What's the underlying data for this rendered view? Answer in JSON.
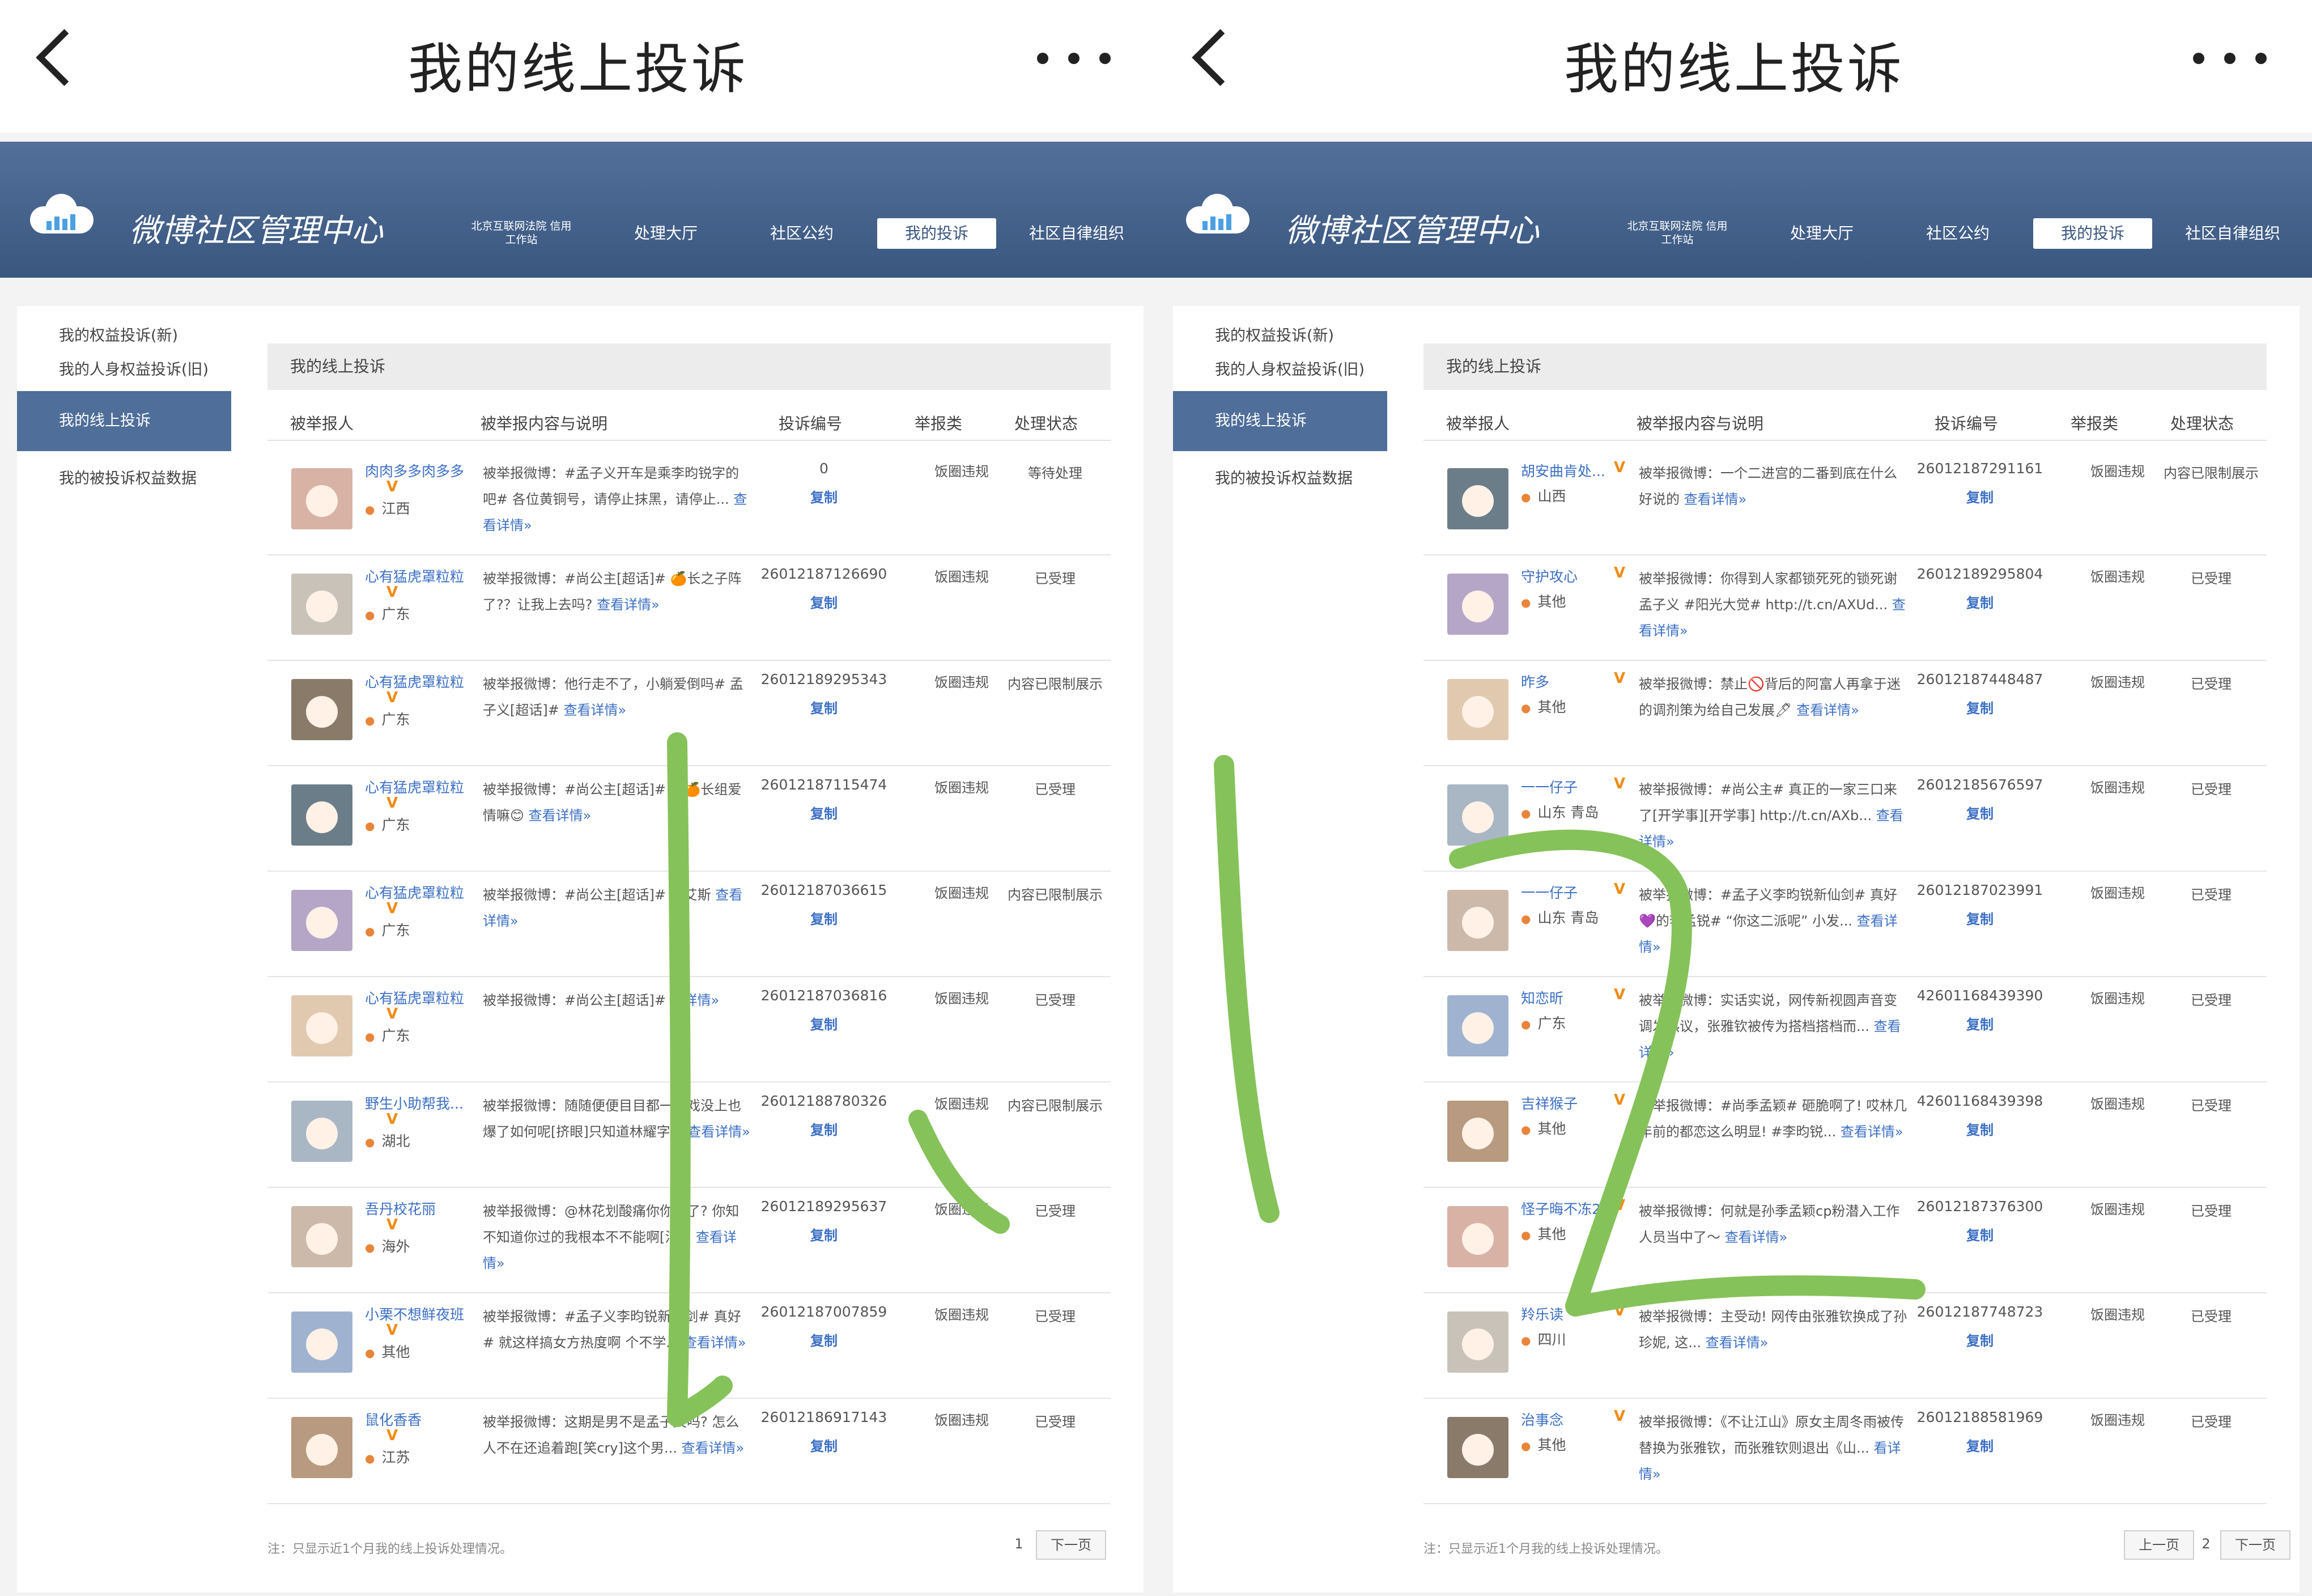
{
  "panels": [
    {
      "title": "我的线上投诉",
      "site_name": "微博社区管理中心",
      "nav": [
        "北京互联网法院 信用工作站",
        "处理大厅",
        "社区公约",
        "我的投诉",
        "社区自律组织"
      ],
      "sidebar": [
        "我的权益投诉(新)",
        "我的人身权益投诉(旧)",
        "我的线上投诉",
        "我的被投诉权益数据"
      ],
      "section_title": "我的线上投诉",
      "columns": [
        "被举报人",
        "被举报内容与说明",
        "投诉编号",
        "举报类",
        "处理状态"
      ],
      "rows": [
        {
          "user": "肉肉多多肉多多",
          "loc": "江西",
          "desc": "被举报微博：#孟子义开车是乘李昀锐字的吧# 各位黄铜号，请停止抹黑，请停止...",
          "more": "查看详情»",
          "no": "0",
          "copy": "复制",
          "type": "饭圈违规",
          "status": "等待处理"
        },
        {
          "user": "心有猛虎罩粒粒",
          "loc": "广东",
          "desc": "被举报微博：#尚公主[超话]# 🍊长之子阵了?？让我上去吗?",
          "more": "查看详情»",
          "no": "26012187126690",
          "copy": "复制",
          "type": "饭圈违规",
          "status": "已受理"
        },
        {
          "user": "心有猛虎罩粒粒",
          "loc": "广东",
          "desc": "被举报微博：他行走不了，小躺爱倒吗# 孟子义[超话]#",
          "more": "查看详情»",
          "no": "26012189295343",
          "copy": "复制",
          "type": "饭圈违规",
          "status": "内容已限制展示"
        },
        {
          "user": "心有猛虎罩粒粒",
          "loc": "广东",
          "desc": "被举报微博：#尚公主[超话]# 的🍊长组爱情嘛😊",
          "more": "查看详情»",
          "no": "26012187115474",
          "copy": "复制",
          "type": "饭圈违规",
          "status": "已受理"
        },
        {
          "user": "心有猛虎罩粒粒",
          "loc": "广东",
          "desc": "被举报微博：#尚公主[超话]# 孟艾斯",
          "more": "查看详情»",
          "no": "26012187036615",
          "copy": "复制",
          "type": "饭圈违规",
          "status": "内容已限制展示"
        },
        {
          "user": "心有猛虎罩粒粒",
          "loc": "广东",
          "desc": "被举报微博：#尚公主[超话]#",
          "more": "看详情»",
          "no": "26012187036816",
          "copy": "复制",
          "type": "饭圈违规",
          "status": "已受理"
        },
        {
          "user": "野生小助帮我...",
          "loc": "湖北",
          "desc": "被举报微博：随随便便目目都一部戏没上也爆了如何呢[挤眼]只知道林耀字...",
          "more": "查看详情»",
          "no": "26012188780326",
          "copy": "复制",
          "type": "饭圈违规",
          "status": "内容已限制展示"
        },
        {
          "user": "吾丹校花丽",
          "loc": "海外",
          "desc": "被举报微博：@林花划酸痛你你咋了? 你知不知道你过的我根本不不能啊[泪...",
          "more": "查看详情»",
          "no": "26012189295637",
          "copy": "复制",
          "type": "饭圈违规",
          "status": "已受理"
        },
        {
          "user": "小栗不想鲜夜班",
          "loc": "其他",
          "desc": "被举报微博：#孟子义李昀锐新仙剑# 真好# 就这样搞女方热度啊 个不学...",
          "more": "查看详情»",
          "no": "26012187007859",
          "copy": "复制",
          "type": "饭圈违规",
          "status": "已受理"
        },
        {
          "user": "鼠化香香",
          "loc": "江苏",
          "desc": "被举报微博：这期是男不是孟子义吗? 怎么人不在还追着跑[笑cry]这个男...",
          "more": "查看详情»",
          "no": "26012186917143",
          "copy": "复制",
          "type": "饭圈违规",
          "status": "已受理"
        }
      ],
      "note": "注：只显示近1个月我的线上投诉处理情况。",
      "pager": [
        "1",
        "下一页"
      ]
    },
    {
      "title": "我的线上投诉",
      "site_name": "微博社区管理中心",
      "nav": [
        "北京互联网法院 信用工作站",
        "处理大厅",
        "社区公约",
        "我的投诉",
        "社区自律组织"
      ],
      "sidebar": [
        "我的权益投诉(新)",
        "我的人身权益投诉(旧)",
        "我的线上投诉",
        "我的被投诉权益数据"
      ],
      "section_title": "我的线上投诉",
      "columns": [
        "被举报人",
        "被举报内容与说明",
        "投诉编号",
        "举报类",
        "处理状态"
      ],
      "rows": [
        {
          "user": "胡安曲肯处...",
          "loc": "山西",
          "desc": "被举报微博：一个二进宫的二番到底在什么好说的",
          "more": "查看详情»",
          "no": "26012187291161",
          "copy": "复制",
          "type": "饭圈违规",
          "status": "内容已限制展示"
        },
        {
          "user": "守护攻心",
          "loc": "其他",
          "desc": "被举报微博：你得到人家都锁死死的锁死谢孟子义 #阳光大觉# http://t.cn/AXUd...",
          "more": "查看详情»",
          "no": "26012189295804",
          "copy": "复制",
          "type": "饭圈违规",
          "status": "已受理"
        },
        {
          "user": "昨多",
          "loc": "其他",
          "desc": "被举报微博：禁止🚫背后的阿富人再拿于迷的调剂策为给自己发展🖊",
          "more": "查看详情»",
          "no": "26012187448487",
          "copy": "复制",
          "type": "饭圈违规",
          "status": "已受理"
        },
        {
          "user": "一一仔子",
          "loc": "山东 青岛",
          "desc": "被举报微博：#尚公主# 真正的一家三口来了[开学事][开学事] http://t.cn/AXb...",
          "more": "查看详情»",
          "no": "26012185676597",
          "copy": "复制",
          "type": "饭圈违规",
          "status": "已受理"
        },
        {
          "user": "一一仔子",
          "loc": "山东 青岛",
          "desc": "被举报微博：#孟子义李昀锐新仙剑# 真好💜的李孟锐# “你这二派呢” 小发...",
          "more": "查看详情»",
          "no": "26012187023991",
          "copy": "复制",
          "type": "饭圈违规",
          "status": "已受理"
        },
        {
          "user": "知恋昕",
          "loc": "广东",
          "desc": "被举报微博：实话实说，网传新视圆声音变调发热议，张雅钦被传为搭档搭档而...",
          "more": "查看详情»",
          "no": "42601168439390",
          "copy": "复制",
          "type": "饭圈违规",
          "status": "已受理"
        },
        {
          "user": "吉祥猴子",
          "loc": "其他",
          "desc": "被举报微博：#尚季孟颖# 砸脆啊了! 哎林几年前的都恋这么明显! #李昀锐...",
          "more": "查看详情»",
          "no": "42601168439398",
          "copy": "复制",
          "type": "饭圈违规",
          "status": "已受理"
        },
        {
          "user": "怪子晦不冻22",
          "loc": "其他",
          "desc": "被举报微博：何就是孙季孟颖cp粉潜入工作人员当中了～",
          "more": "查看详情»",
          "no": "26012187376300",
          "copy": "复制",
          "type": "饭圈违规",
          "status": "已受理"
        },
        {
          "user": "羚乐读",
          "loc": "四川",
          "desc": "被举报微博：主受动! 网传由张雅钦换成了孙珍妮, 这...",
          "more": "查看详情»",
          "no": "26012187748723",
          "copy": "复制",
          "type": "饭圈违规",
          "status": "已受理"
        },
        {
          "user": "治事念",
          "loc": "其他",
          "desc": "被举报微博：《不让江山》原女主周冬雨被传替换为张雅钦，而张雅钦则退出《山...",
          "more": "看详情»",
          "no": "26012188581969",
          "copy": "复制",
          "type": "饭圈违规",
          "status": "已受理"
        }
      ],
      "note": "注：只显示近1个月我的线上投诉处理情况。",
      "pager": [
        "上一页",
        "2",
        "下一页"
      ]
    }
  ],
  "colors": {
    "header_blue": "#3a5780",
    "active_side": "#4f6e99",
    "link_blue": "#3b6fc4",
    "scribble_green": "#86c25a"
  },
  "icons": [
    "back-icon",
    "more-icon",
    "cloud-icon",
    "vip-icon",
    "location-icon"
  ]
}
